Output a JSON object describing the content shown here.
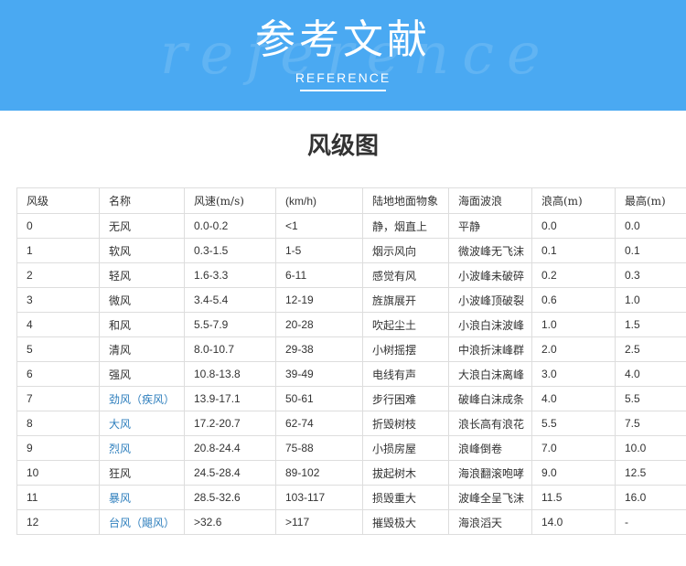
{
  "banner": {
    "title": "参考文献",
    "subtitle": "REFERENCE",
    "watermark": "reference",
    "background_color": "#4aa9f2"
  },
  "section_title": "风级图",
  "table": {
    "headers": [
      "风级",
      "名称",
      "风速(m/s)",
      "(km/h)",
      "陆地地面物象",
      "海面波浪",
      "浪高(m)",
      "最高(m)"
    ],
    "rows": [
      [
        "0",
        "无风",
        "0.0-0.2",
        "<1",
        "静，烟直上",
        "平静",
        "0.0",
        "0.0"
      ],
      [
        "1",
        "软风",
        "0.3-1.5",
        "1-5",
        "烟示风向",
        "微波峰无飞沫",
        "0.1",
        "0.1"
      ],
      [
        "2",
        "轻风",
        "1.6-3.3",
        "6-11",
        "感觉有风",
        "小波峰未破碎",
        "0.2",
        "0.3"
      ],
      [
        "3",
        "微风",
        "3.4-5.4",
        "12-19",
        "旌旗展开",
        "小波峰顶破裂",
        "0.6",
        "1.0"
      ],
      [
        "4",
        "和风",
        "5.5-7.9",
        "20-28",
        "吹起尘土",
        "小浪白沫波峰",
        "1.0",
        "1.5"
      ],
      [
        "5",
        "清风",
        "8.0-10.7",
        "29-38",
        "小树摇摆",
        "中浪折沫峰群",
        "2.0",
        "2.5"
      ],
      [
        "6",
        "强风",
        "10.8-13.8",
        "39-49",
        "电线有声",
        "大浪白沫离峰",
        "3.0",
        "4.0"
      ],
      [
        "7",
        "劲风（疾风）",
        "13.9-17.1",
        "50-61",
        "步行困难",
        "破峰白沫成条",
        "4.0",
        "5.5"
      ],
      [
        "8",
        "大风",
        "17.2-20.7",
        "62-74",
        "折毁树枝",
        "浪长高有浪花",
        "5.5",
        "7.5"
      ],
      [
        "9",
        "烈风",
        "20.8-24.4",
        "75-88",
        "小损房屋",
        "浪峰倒卷",
        "7.0",
        "10.0"
      ],
      [
        "10",
        "狂风",
        "24.5-28.4",
        "89-102",
        "拔起树木",
        "海浪翻滚咆哮",
        "9.0",
        "12.5"
      ],
      [
        "11",
        "暴风",
        "28.5-32.6",
        "103-117",
        "损毁重大",
        "波峰全呈飞沫",
        "11.5",
        "16.0"
      ],
      [
        "12",
        "台风（飓风）",
        ">32.6",
        ">117",
        "摧毁极大",
        "海浪滔天",
        "14.0",
        "-"
      ]
    ],
    "linked_name_rows": [
      7,
      8,
      9,
      11,
      12
    ],
    "link_color": "#2f7fbd"
  }
}
